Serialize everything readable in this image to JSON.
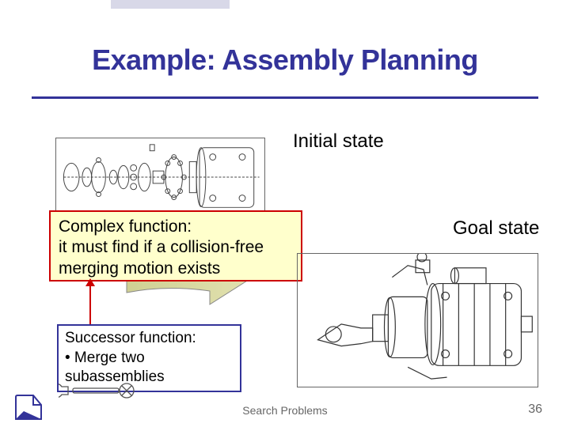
{
  "title": "Example: Assembly Planning",
  "labels": {
    "initial": "Initial state",
    "goal": "Goal state"
  },
  "callouts": {
    "complex": "Complex function:\nit must find if a collision-free merging motion exists",
    "successor_line1": "Successor function:",
    "successor_line2": "• Merge two subassemblies"
  },
  "footer": {
    "title": "Search Problems",
    "page": "36"
  },
  "colors": {
    "accent": "#333399",
    "highlight_border": "#cc0000",
    "highlight_fill": "#ffffcc"
  }
}
